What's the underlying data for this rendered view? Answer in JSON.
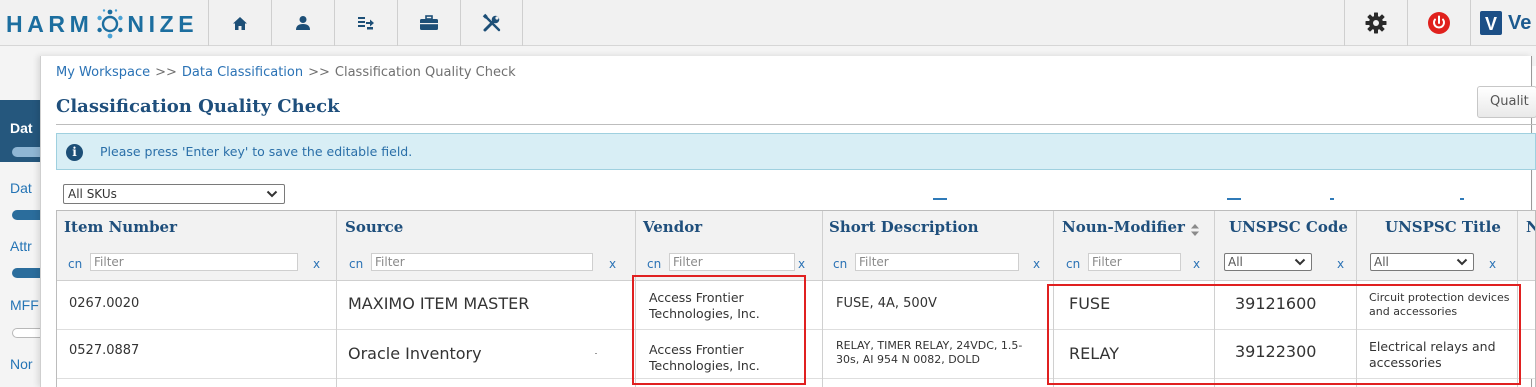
{
  "app": {
    "logo_left": "HARM",
    "logo_right": "NIZE",
    "brand_partial": "Ve",
    "brand_badge": "V"
  },
  "nav": {
    "tabs": [
      {
        "icon": "home-icon"
      },
      {
        "icon": "user-icon"
      },
      {
        "icon": "data-transform-icon"
      },
      {
        "icon": "briefcase-icon"
      },
      {
        "icon": "tools-icon"
      }
    ],
    "right_tools": [
      {
        "icon": "gear-icon"
      },
      {
        "icon": "power-icon",
        "color": "#e0211d"
      }
    ]
  },
  "sidebar": {
    "tabs": [
      "Dat",
      "Dat",
      "Attr",
      "MFF",
      "Nor"
    ]
  },
  "breadcrumb": {
    "items": [
      "My Workspace",
      "Data Classification",
      "Classification Quality Check"
    ],
    "separator": ">>"
  },
  "page": {
    "title": "Classification Quality Check",
    "quality_button": "Qualit"
  },
  "info": {
    "message": "Please press 'Enter key' to save the editable field."
  },
  "sku_filter": {
    "selected": "All SKUs"
  },
  "grid": {
    "columns": [
      {
        "label": "Item Number",
        "filter_op": "cn",
        "filter_placeholder": "Filter",
        "clear": "x"
      },
      {
        "label": "Source",
        "filter_op": "cn",
        "filter_placeholder": "Filter",
        "clear": "x"
      },
      {
        "label": "Vendor",
        "filter_op": "cn",
        "filter_placeholder": "Filter",
        "clear": "x"
      },
      {
        "label": "Short Description",
        "filter_op": "cn",
        "filter_placeholder": "Filter",
        "clear": "x"
      },
      {
        "label": "Noun-Modifier",
        "filter_op": "cn",
        "filter_placeholder": "Filter",
        "clear": "x"
      },
      {
        "label": "UNSPSC Code",
        "filter_select": "All",
        "clear": "x"
      },
      {
        "label": "UNSPSC Title",
        "filter_select": "All",
        "clear": "x"
      },
      {
        "label": "N"
      }
    ],
    "rows": [
      {
        "item_number": "0267.0020",
        "source": "MAXIMO ITEM MASTER",
        "vendor": "Access Frontier Technologies, Inc.",
        "short_description": "FUSE, 4A, 500V",
        "noun_modifier": "FUSE",
        "unspsc_code": "39121600",
        "unspsc_title": "Circuit protection devices and accessories"
      },
      {
        "item_number": "0527.0887",
        "source": "Oracle Inventory",
        "vendor": "Access Frontier Technologies, Inc.",
        "short_description": "RELAY, TIMER RELAY, 24VDC, 1.5-30s, AI 954 N 0082, DOLD",
        "noun_modifier": "RELAY",
        "unspsc_code": "39122300",
        "unspsc_title": "Electrical relays and accessories"
      }
    ]
  },
  "colors": {
    "brand_blue": "#1c6e9f",
    "title_blue": "#1f4f7c",
    "link_blue": "#2a72b5",
    "highlight_red": "#e02020",
    "info_bg": "#d8eef5"
  }
}
